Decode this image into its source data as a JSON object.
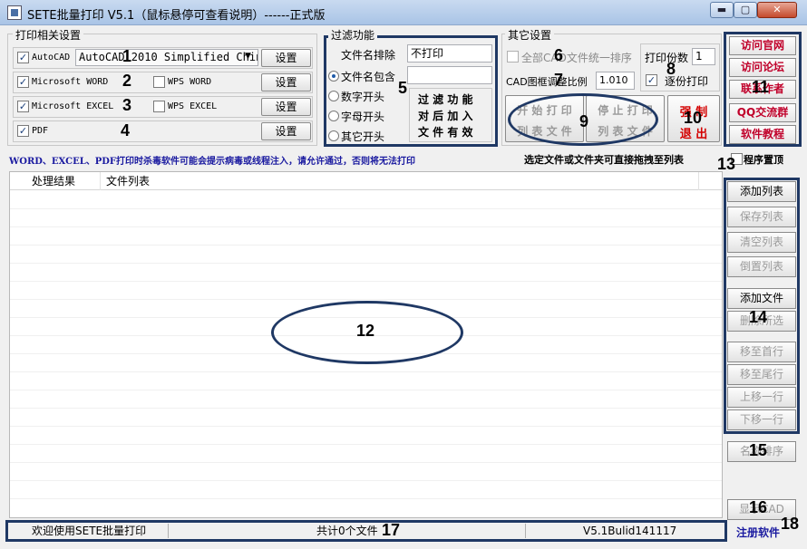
{
  "window": {
    "title": "SETE批量打印 V5.1（鼠标悬停可查看说明）------正式版",
    "min_glyph": "▬",
    "max_glyph": "▢",
    "close_glyph": "✕"
  },
  "print_settings": {
    "title": "打印相关设置",
    "autocad_label": "AutoCAD",
    "autocad_version": "AutoCAD 2010 Simplified Chines",
    "word_label": "Microsoft WORD",
    "wps_word_label": "WPS WORD",
    "excel_label": "Microsoft EXCEL",
    "wps_excel_label": "WPS EXCEL",
    "pdf_label": "PDF",
    "setting_label": "设置",
    "check_mark": "✓",
    "dropdown_glyph": "▼"
  },
  "filter": {
    "title": "过滤功能",
    "exclude_label": "文件名排除",
    "exclude_value": "不打印",
    "include_label": "文件名包含",
    "include_value": "",
    "digit_label": "数字开头",
    "letter_label": "字母开头",
    "other_label": "其它开头",
    "note_line1": "过 滤 功 能",
    "note_line2": "对 后 加 入",
    "note_line3": "文 件 有 效"
  },
  "other": {
    "title": "其它设置",
    "sort_label": "全部CAD文件统一排序",
    "scale_label": "CAD图框调整比例",
    "scale_value": "1.010",
    "copies_label": "打印份数",
    "copies_value": "1",
    "collate_label": "逐份打印",
    "start_line1": "开 始 打 印",
    "start_line2": "列 表 文 件",
    "stop_line1": "停 止 打 印",
    "stop_line2": "列 表 文 件",
    "force_line1": "强  制",
    "force_line2": "退  出"
  },
  "links": {
    "site": "访问官网",
    "forum": "访问论坛",
    "author": "联系作者",
    "qq": "QQ交流群",
    "tutorial": "软件教程"
  },
  "notices": {
    "warning": "WORD、EXCEL、PDF打印时杀毒软件可能会提示病毒或线程注入，请允许通过，否则将无法打印",
    "drag_hint": "选定文件或文件夹可直接拖拽至列表",
    "topmost_label": "程序置顶"
  },
  "list": {
    "col_result": "处理结果",
    "col_files": "文件列表"
  },
  "side": {
    "add_list": "添加列表",
    "save_list": "保存列表",
    "clear_list": "清空列表",
    "reverse_list": "倒置列表",
    "add_file": "添加文件",
    "delete_selected": "删除所选",
    "move_first": "移至首行",
    "move_last": "移至尾行",
    "move_up": "上移一行",
    "move_down": "下移一行",
    "name_sort": "名称排序",
    "show_cad": "显示CAD",
    "register": "注册软件"
  },
  "status": {
    "welcome": "欢迎使用SETE批量打印",
    "count": "共计0个文件",
    "version": "V5.1Bulid141117"
  },
  "markers": {
    "m1": "1",
    "m2": "2",
    "m3": "3",
    "m4": "4",
    "m5": "5",
    "m6": "6",
    "m7": "7",
    "m8": "8",
    "m9": "9",
    "m10": "10",
    "m11": "11",
    "m12": "12",
    "m13": "13",
    "m14": "14",
    "m15": "15",
    "m16": "16",
    "m17": "17",
    "m18": "18"
  },
  "colors": {
    "annotation": "#1f3864",
    "link_red": "#c0002a",
    "notice_blue": "#1a1aa0"
  }
}
